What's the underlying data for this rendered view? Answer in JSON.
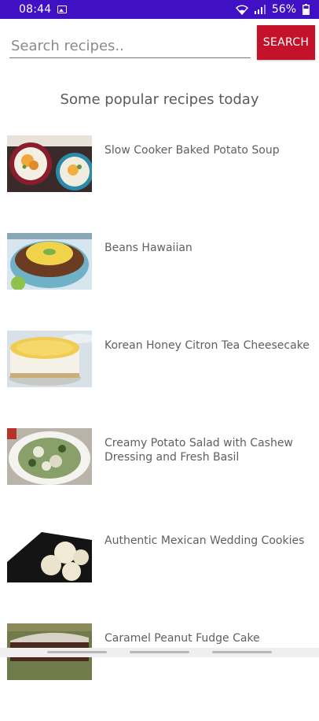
{
  "status_bar": {
    "time": "08:44",
    "battery": "56%"
  },
  "search": {
    "placeholder": "Search recipes..",
    "value": "",
    "button_label": "SEARCH"
  },
  "section_title": "Some popular recipes today",
  "recipes": [
    {
      "title": "Slow Cooker Baked Potato Soup"
    },
    {
      "title": "Beans Hawaiian"
    },
    {
      "title": "Korean Honey Citron Tea Cheesecake"
    },
    {
      "title": "Creamy Potato Salad with Cashew Dressing and Fresh Basil"
    },
    {
      "title": "Authentic Mexican Wedding Cookies"
    },
    {
      "title": "Caramel Peanut Fudge Cake"
    }
  ],
  "colors": {
    "status_bar": "#3f10c4",
    "search_button": "#c4122a"
  }
}
